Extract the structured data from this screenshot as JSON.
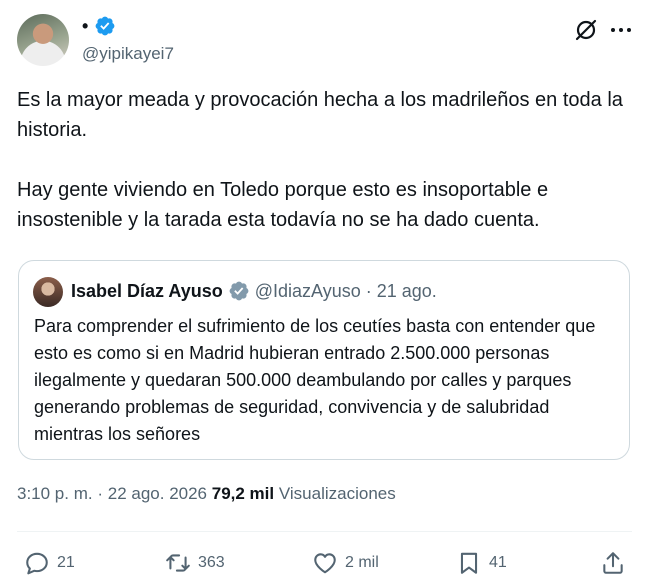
{
  "author": {
    "display_name": "•",
    "handle": "@yipikayei7",
    "avatar_icon": "user-avatar-photo",
    "verified": true
  },
  "tweet": {
    "paragraph1": "Es la mayor meada y provocación hecha a los madrileños en toda la historia.",
    "paragraph2": "Hay gente viviendo en Toledo porque esto es insoportable e insostenible y la tarada esta todavía no se ha dado cuenta."
  },
  "quote": {
    "name": "Isabel Díaz Ayuso",
    "handle": "@IdiazAyuso",
    "separator": "·",
    "date": "21 ago.",
    "badge": "grey-verified-badge",
    "text": "Para comprender el sufrimiento de los ceutíes basta con entender que esto es como si en Madrid hubieran entrado 2.500.000 personas ilegalmente y quedaran 500.000 deambulando por calles y parques generando problemas de seguridad, convivencia y de salubridad mientras los señores"
  },
  "meta": {
    "time": "3:10 p. m.",
    "separator": "·",
    "date": "22 ago. 2026",
    "views_count": "79,2 mil",
    "views_label": "Visualizaciones"
  },
  "actions": {
    "replies": "21",
    "reposts": "363",
    "likes": "2 mil",
    "bookmarks": "41"
  },
  "colors": {
    "text": "#0f1419",
    "secondary": "#536471",
    "verified_blue": "#1d9bf0",
    "border": "#cfd9de"
  }
}
